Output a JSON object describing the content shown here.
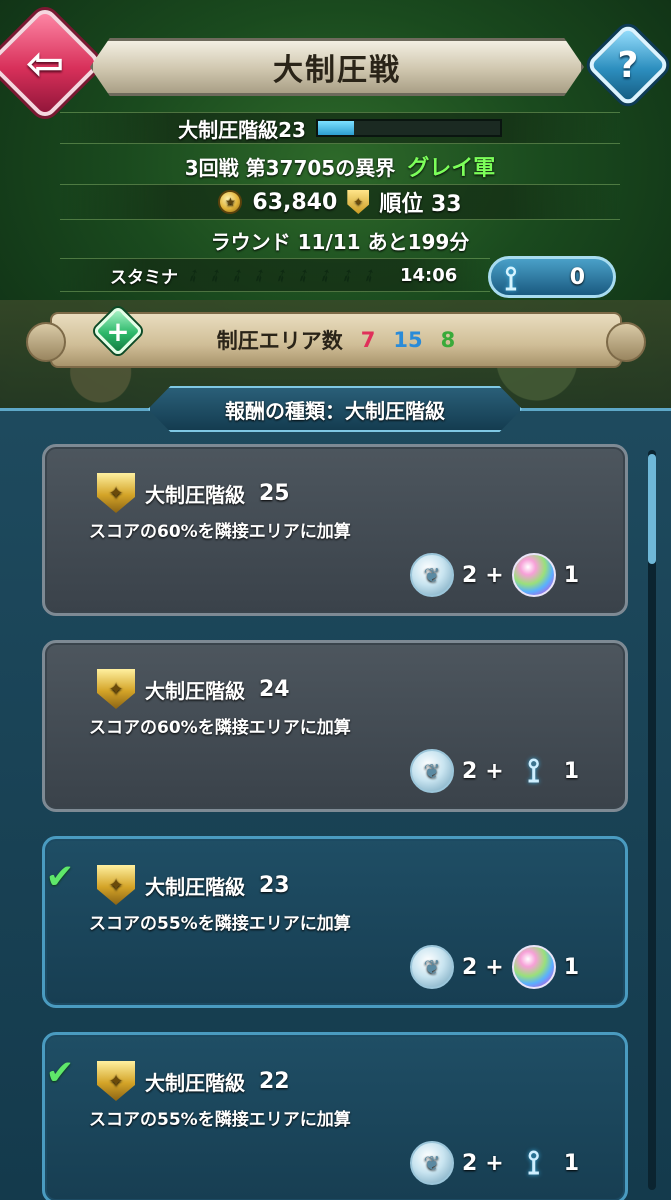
{
  "header": {
    "title": "大制圧戦",
    "back_icon": "back-arrow-icon",
    "help_label": "?"
  },
  "status": {
    "rank_label": "大制圧階級23",
    "rank_progress_percent": 20,
    "battle_text": "3回戦 第37705の異界",
    "army_name": "グレイ軍",
    "score": "63,840",
    "rank_position_label": "順位 33",
    "round_text": "ラウンド 11/11 あと199分",
    "stamina_label": "スタミナ",
    "stamina_slots": 9,
    "stamina_time": "14:06",
    "dueling_crest_count": "0"
  },
  "area": {
    "label": "制圧エリア数",
    "red": "7",
    "blue": "15",
    "green": "8",
    "colors": {
      "red": "#e0305a",
      "blue": "#2a8bd8",
      "green": "#3aaa3a"
    }
  },
  "rewards": {
    "header": "報酬の種類：大制圧階級",
    "items": [
      {
        "label": "大制圧階級",
        "level": "25",
        "desc": "スコアの60%を隣接エリアに加算",
        "reward_count": "2",
        "bonus_type": "orb",
        "bonus_count": "1",
        "completed": false
      },
      {
        "label": "大制圧階級",
        "level": "24",
        "desc": "スコアの60%を隣接エリアに加算",
        "reward_count": "2",
        "bonus_type": "dueling-crest",
        "bonus_count": "1",
        "completed": false
      },
      {
        "label": "大制圧階級",
        "level": "23",
        "desc": "スコアの55%を隣接エリアに加算",
        "reward_count": "2",
        "bonus_type": "orb",
        "bonus_count": "1",
        "completed": true
      },
      {
        "label": "大制圧階級",
        "level": "22",
        "desc": "スコアの55%を隣接エリアに加算",
        "reward_count": "2",
        "bonus_type": "dueling-crest",
        "bonus_count": "1",
        "completed": true
      }
    ],
    "plus_sign": "+"
  }
}
